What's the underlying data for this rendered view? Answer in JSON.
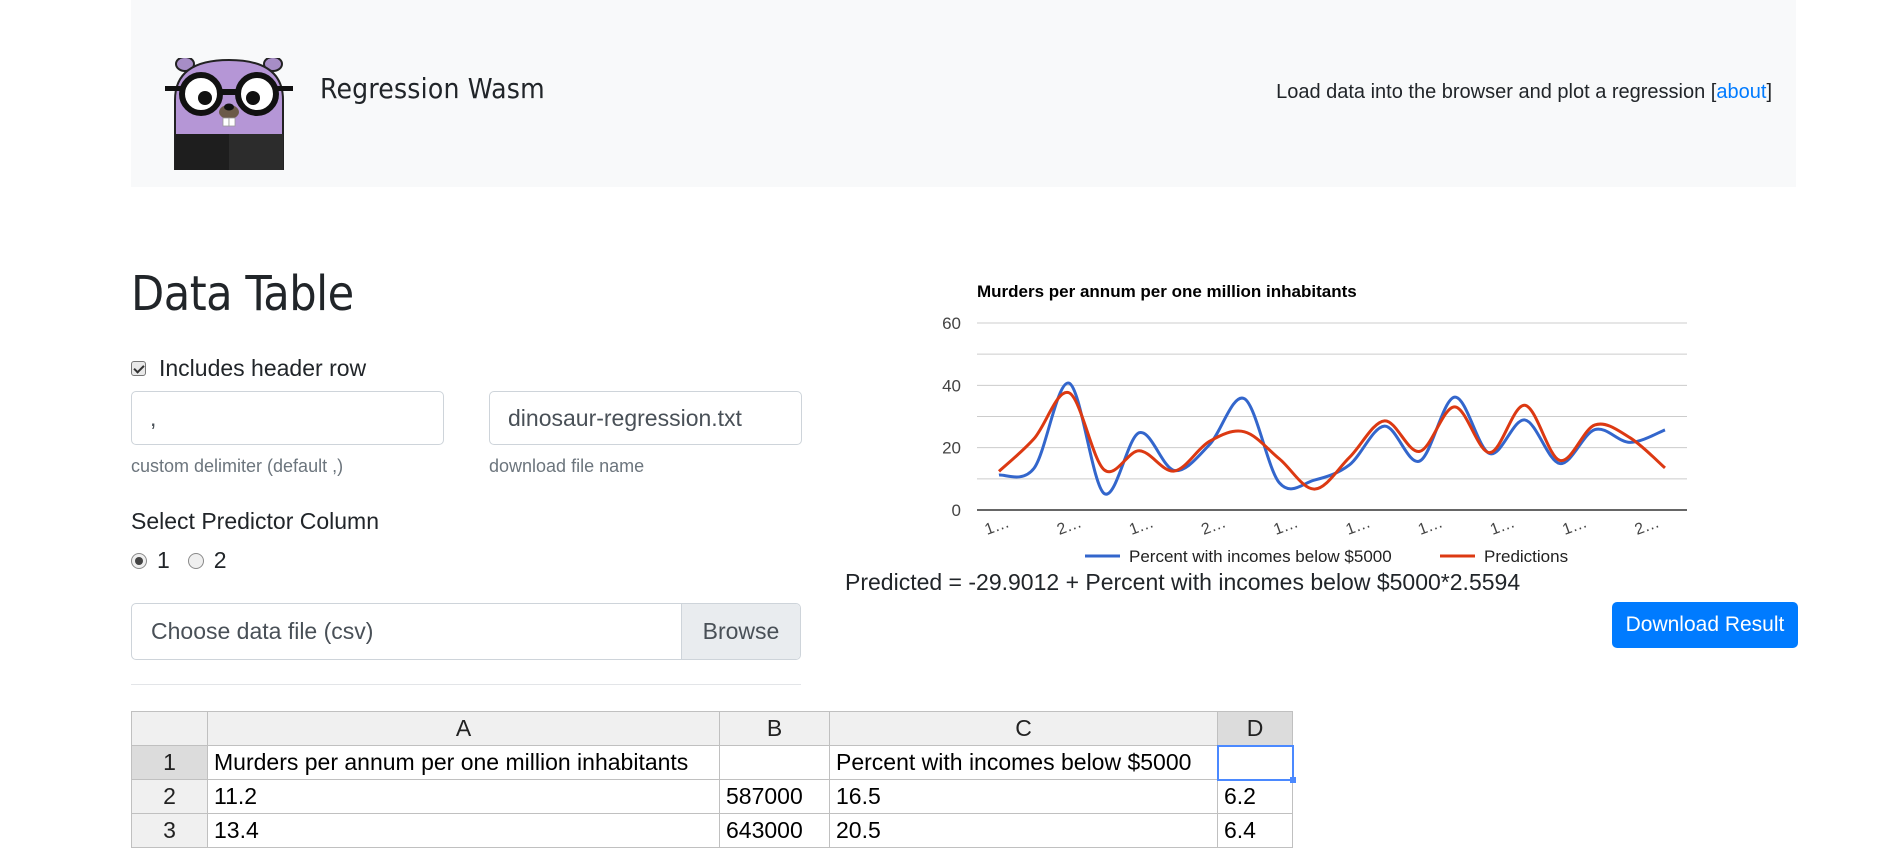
{
  "header": {
    "app_title": "Regression Wasm",
    "tagline": "Load data into the browser and plot a regression [",
    "about_link": "about",
    "tagline_end": "]"
  },
  "data_panel": {
    "title": "Data Table",
    "includes_header_label": "Includes header row",
    "includes_header_checked": true,
    "delimiter_value": ",",
    "delimiter_help": "custom delimiter (default ,)",
    "filename_value": "dinosaur-regression.txt",
    "filename_help": "download file name",
    "predictor_label": "Select Predictor Column",
    "predictor_options": [
      "1",
      "2"
    ],
    "predictor_selected": "1",
    "file_placeholder": "Choose data file (csv)",
    "browse_label": "Browse"
  },
  "sheet": {
    "columns": [
      "A",
      "B",
      "C",
      "D"
    ],
    "rows": [
      {
        "num": "1",
        "cells": [
          "Murders per annum per one million inhabitants",
          "",
          "Percent with incomes below $5000",
          ""
        ]
      },
      {
        "num": "2",
        "cells": [
          "11.2",
          "587000",
          "16.5",
          "6.2"
        ]
      },
      {
        "num": "3",
        "cells": [
          "13.4",
          "643000",
          "20.5",
          "6.4"
        ]
      }
    ]
  },
  "result": {
    "equation": "Predicted = -29.9012 + Percent with incomes below $5000*2.5594",
    "download_label": "Download Result"
  },
  "colors": {
    "accent": "#007bff",
    "series_actual": "#3366cc",
    "series_predicted": "#dc3912"
  },
  "chart_data": {
    "type": "line",
    "title": "Murders per annum per one million inhabitants",
    "ylim": [
      0,
      60
    ],
    "yticks": [
      "0",
      "20",
      "40",
      "60"
    ],
    "x_tick_labels": [
      "1…",
      "2…",
      "1…",
      "2…",
      "1…",
      "1…",
      "1…",
      "1…",
      "1…",
      "2…"
    ],
    "x": [
      1,
      2,
      3,
      4,
      5,
      6,
      7,
      8,
      9,
      10,
      11,
      12,
      13,
      14,
      15,
      16,
      17,
      18,
      19,
      20
    ],
    "grid": true,
    "legend_position": "bottom",
    "series": [
      {
        "name": "Percent with incomes below $5000",
        "values": [
          11.2,
          13.4,
          40.7,
          5.3,
          24.8,
          12.7,
          20.9,
          35.7,
          8.7,
          9.6,
          14.5,
          26.9,
          15.7,
          36.2,
          18.1,
          28.9,
          14.9,
          25.8,
          21.7,
          25.7
        ]
      },
      {
        "name": "Predictions",
        "values": [
          12.4,
          22.9,
          37.6,
          12.9,
          19.0,
          12.5,
          22.0,
          25.1,
          16.4,
          6.7,
          16.9,
          28.6,
          18.8,
          33.1,
          18.4,
          33.6,
          15.9,
          27.3,
          23.2,
          13.5
        ]
      }
    ]
  }
}
